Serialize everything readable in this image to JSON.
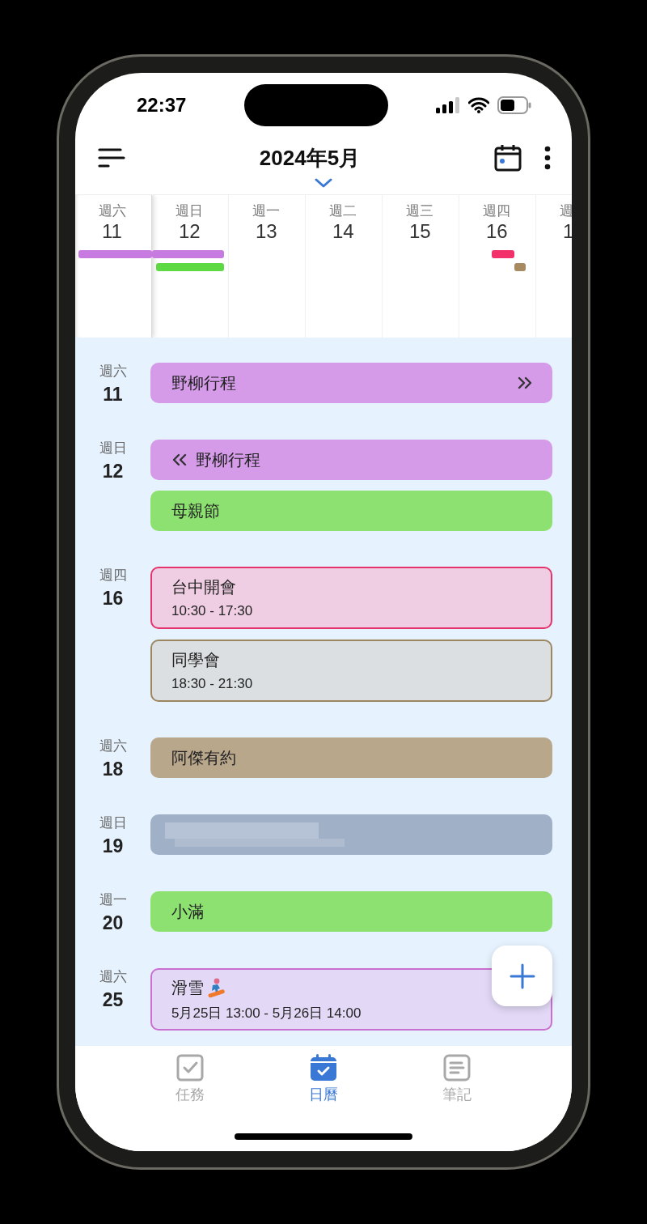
{
  "status_bar": {
    "time": "22:37"
  },
  "header": {
    "title": "2024年5月"
  },
  "week_strip": {
    "days": [
      {
        "weekday": "週六",
        "date": "11",
        "selected": true,
        "bars": [
          {
            "kind": "start",
            "color": "#c77ae0"
          }
        ]
      },
      {
        "weekday": "週日",
        "date": "12",
        "selected": false,
        "bars": [
          {
            "kind": "end",
            "color": "#c77ae0"
          },
          {
            "kind": "full",
            "color": "#5dd943"
          }
        ]
      },
      {
        "weekday": "週一",
        "date": "13",
        "selected": false
      },
      {
        "weekday": "週二",
        "date": "14",
        "selected": false
      },
      {
        "weekday": "週三",
        "date": "15",
        "selected": false
      },
      {
        "weekday": "週四",
        "date": "16",
        "selected": false,
        "bars": [
          {
            "kind": "short",
            "color": "#f2306a"
          },
          {
            "kind": "dot",
            "color": "#a88a60"
          }
        ]
      },
      {
        "weekday": "週",
        "date": "1",
        "selected": false
      }
    ]
  },
  "agenda": {
    "groups": [
      {
        "weekday": "週六",
        "date": "11",
        "events": [
          {
            "kind": "allday",
            "title": "野柳行程",
            "color": "#d59be9",
            "continues_before": false,
            "continues_after": true
          }
        ]
      },
      {
        "weekday": "週日",
        "date": "12",
        "events": [
          {
            "kind": "allday",
            "title": "野柳行程",
            "color": "#d59be9",
            "continues_before": true,
            "continues_after": false
          },
          {
            "kind": "allday",
            "title": "母親節",
            "color": "#8ce170",
            "continues_before": false,
            "continues_after": false
          }
        ]
      },
      {
        "weekday": "週四",
        "date": "16",
        "events": [
          {
            "kind": "timed",
            "title": "台中開會",
            "time": "10:30 - 17:30",
            "color": "#efcde2",
            "outline": {
              "color": "#e5336b"
            },
            "emoji": false
          },
          {
            "kind": "timed",
            "title": "同學會",
            "time": "18:30 - 21:30",
            "color": "#dcdfe2",
            "outline": {
              "color": "#9c8660"
            },
            "emoji": false
          }
        ]
      },
      {
        "weekday": "週六",
        "date": "18",
        "events": [
          {
            "kind": "allday",
            "title": "阿傑有約",
            "color": "#b9a78c",
            "continues_before": false,
            "continues_after": false
          }
        ]
      },
      {
        "weekday": "週日",
        "date": "19",
        "events": [
          {
            "kind": "blurred",
            "color": "#a0b0c7"
          }
        ]
      },
      {
        "weekday": "週一",
        "date": "20",
        "events": [
          {
            "kind": "allday",
            "title": "小滿",
            "color": "#8ce170",
            "continues_before": false,
            "continues_after": false
          }
        ]
      },
      {
        "weekday": "週六",
        "date": "25",
        "events": [
          {
            "kind": "timed",
            "title": "滑雪",
            "time": "5月25日 13:00 - 5月26日 14:00",
            "color": "#e3d9f7",
            "outline": {
              "color": "#c86fd0"
            },
            "emoji": true
          }
        ]
      }
    ]
  },
  "bottom_nav": {
    "tabs": [
      {
        "kind": "tasks",
        "label": "任務",
        "selected": false
      },
      {
        "kind": "calendar",
        "label": "日曆",
        "selected": true
      },
      {
        "kind": "notes",
        "label": "筆記",
        "selected": false
      }
    ]
  }
}
